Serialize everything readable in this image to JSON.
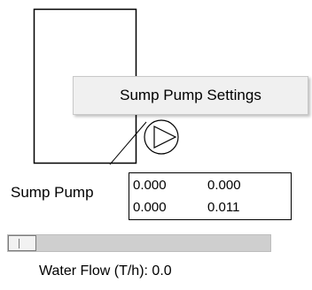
{
  "context_menu": {
    "items": [
      {
        "label": "Sump Pump Settings"
      }
    ]
  },
  "pump": {
    "label": "Sump Pump",
    "readout": [
      [
        "0.000",
        "0.000"
      ],
      [
        "0.000",
        "0.011"
      ]
    ]
  },
  "slider": {
    "value_fraction": 0.0
  },
  "water_flow": {
    "label": "Water Flow (T/h):",
    "value": "0.0"
  }
}
